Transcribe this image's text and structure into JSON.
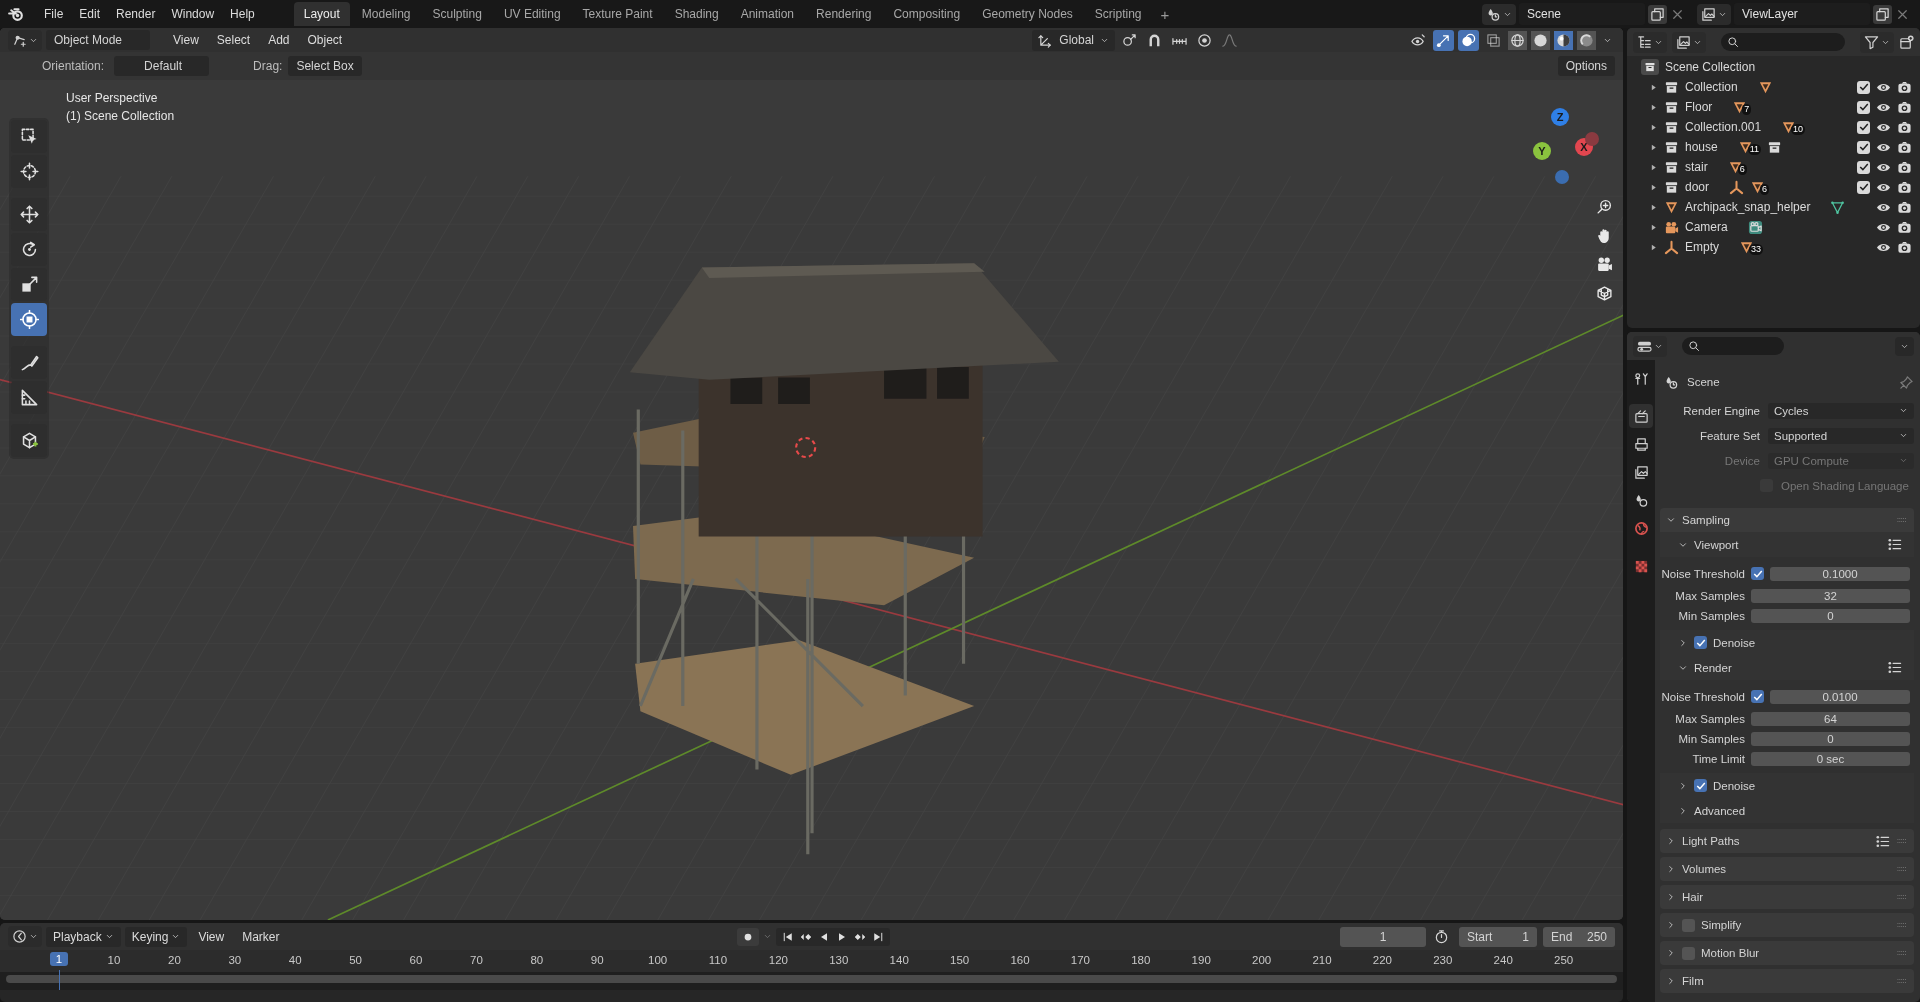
{
  "menu": [
    "File",
    "Edit",
    "Render",
    "Window",
    "Help"
  ],
  "workspaces": [
    {
      "label": "Layout",
      "selected": true
    },
    {
      "label": "Modeling",
      "selected": false
    },
    {
      "label": "Sculpting",
      "selected": false
    },
    {
      "label": "UV Editing",
      "selected": false
    },
    {
      "label": "Texture Paint",
      "selected": false
    },
    {
      "label": "Shading",
      "selected": false
    },
    {
      "label": "Animation",
      "selected": false
    },
    {
      "label": "Rendering",
      "selected": false
    },
    {
      "label": "Compositing",
      "selected": false
    },
    {
      "label": "Geometry Nodes",
      "selected": false
    },
    {
      "label": "Scripting",
      "selected": false
    }
  ],
  "add_workspace": "+",
  "scene": "Scene",
  "view_layer": "ViewLayer",
  "viewport_header": {
    "mode": "Object Mode",
    "menus": [
      "View",
      "Select",
      "Add",
      "Object"
    ],
    "orientation": "Global",
    "shading": [
      {
        "kind": "wireframe",
        "selected": false
      },
      {
        "kind": "solid",
        "selected": false
      },
      {
        "kind": "material",
        "selected": true
      },
      {
        "kind": "rendered",
        "selected": false
      }
    ]
  },
  "tool_settings": {
    "orientation_label": "Orientation:",
    "orientation": "Default",
    "drag_label": "Drag:",
    "drag": "Select Box",
    "options": "Options"
  },
  "viewport": {
    "view_name": "User Perspective",
    "collection": "(1) Scene Collection",
    "tools": [
      {
        "kind": "select",
        "selected": false
      },
      {
        "kind": "cursor",
        "selected": false
      },
      {
        "kind": "move",
        "selected": false
      },
      {
        "kind": "rotate",
        "selected": false
      },
      {
        "kind": "scale",
        "selected": false
      },
      {
        "kind": "transform",
        "selected": true
      },
      {
        "kind": "annotate",
        "selected": false
      },
      {
        "kind": "measure",
        "selected": false
      },
      {
        "kind": "add-cube",
        "selected": false
      }
    ],
    "gizmo": [
      {
        "label": "Z",
        "color": "#2f7fe6"
      },
      {
        "label": "Y",
        "color": "#8ac33e"
      },
      {
        "label": "X",
        "color": "#e2464f"
      }
    ]
  },
  "outliner": {
    "root": "Scene Collection",
    "items": [
      {
        "name": "Collection",
        "kind": "collection",
        "checked": true,
        "extras": [
          {
            "kind": "mesh"
          }
        ]
      },
      {
        "name": "Floor",
        "kind": "collection",
        "checked": true,
        "extras": [
          {
            "kind": "mesh",
            "count": "7"
          }
        ]
      },
      {
        "name": "Collection.001",
        "kind": "collection",
        "checked": true,
        "extras": [
          {
            "kind": "mesh",
            "count": "10"
          }
        ]
      },
      {
        "name": "house",
        "kind": "collection",
        "checked": true,
        "extras": [
          {
            "kind": "mesh",
            "count": "11"
          },
          {
            "kind": "collection"
          }
        ]
      },
      {
        "name": "stair",
        "kind": "collection",
        "checked": true,
        "extras": [
          {
            "kind": "mesh",
            "count": "6"
          }
        ]
      },
      {
        "name": "door",
        "kind": "collection",
        "checked": true,
        "extras": [
          {
            "kind": "empty"
          },
          {
            "kind": "mesh",
            "count": "6"
          }
        ]
      },
      {
        "name": "Archipack_snap_helper",
        "kind": "mesh",
        "extras": [
          {
            "kind": "mesh-data"
          }
        ]
      },
      {
        "name": "Camera",
        "kind": "camera",
        "extras": [
          {
            "kind": "camera-data"
          }
        ]
      },
      {
        "name": "Empty",
        "kind": "empty",
        "extras": [
          {
            "kind": "mesh",
            "count": "33"
          }
        ]
      }
    ]
  },
  "properties": {
    "tabs": [
      {
        "kind": "tool",
        "selected": false
      },
      {
        "kind": "render",
        "selected": true
      },
      {
        "kind": "output",
        "selected": false
      },
      {
        "kind": "view-layer",
        "selected": false
      },
      {
        "kind": "scene",
        "selected": false
      },
      {
        "kind": "world",
        "selected": false
      },
      {
        "kind": "texture",
        "selected": false
      }
    ],
    "context": "Scene",
    "fields": [
      {
        "label": "Render Engine",
        "value": "Cycles",
        "disabled": false
      },
      {
        "label": "Feature Set",
        "value": "Supported",
        "disabled": false
      },
      {
        "label": "Device",
        "value": "GPU Compute",
        "disabled": true
      }
    ],
    "osl": {
      "label": "Open Shading Language",
      "checked": false,
      "disabled": true
    },
    "panels": [
      {
        "title": "Sampling",
        "expanded": true,
        "presets": false,
        "children": [
          {
            "kind": "subpanel",
            "title": "Viewport",
            "expanded": true,
            "presets": true,
            "rows": [
              {
                "kind": "check-number",
                "label": "Noise Threshold",
                "checked": true,
                "value": "0.1000"
              },
              {
                "kind": "number",
                "label": "Max Samples",
                "value": "32"
              },
              {
                "kind": "number",
                "label": "Min Samples",
                "value": "0"
              }
            ]
          },
          {
            "kind": "check-subpanel",
            "title": "Denoise",
            "checked": true,
            "expanded": false
          },
          {
            "kind": "subpanel",
            "title": "Render",
            "expanded": true,
            "presets": true,
            "rows": [
              {
                "kind": "check-number",
                "label": "Noise Threshold",
                "checked": true,
                "value": "0.0100"
              },
              {
                "kind": "number",
                "label": "Max Samples",
                "value": "64"
              },
              {
                "kind": "number",
                "label": "Min Samples",
                "value": "0"
              },
              {
                "kind": "number",
                "label": "Time Limit",
                "value": "0 sec"
              }
            ]
          },
          {
            "kind": "check-subpanel",
            "title": "Denoise",
            "checked": true,
            "expanded": false
          },
          {
            "kind": "subpanel",
            "title": "Advanced",
            "expanded": false,
            "presets": false
          }
        ]
      },
      {
        "title": "Light Paths",
        "expanded": false,
        "presets": true
      },
      {
        "title": "Volumes",
        "expanded": false,
        "presets": false
      },
      {
        "title": "Hair",
        "expanded": false,
        "presets": false
      },
      {
        "title": "Simplify",
        "expanded": false,
        "presets": false,
        "checked": false
      },
      {
        "title": "Motion Blur",
        "expanded": false,
        "presets": false,
        "checked": false
      },
      {
        "title": "Film",
        "expanded": false,
        "presets": false
      }
    ]
  },
  "timeline": {
    "menus": [
      {
        "label": "Playback",
        "dropdown": true
      },
      {
        "label": "Keying",
        "dropdown": true
      },
      {
        "label": "View",
        "dropdown": false
      },
      {
        "label": "Marker",
        "dropdown": false
      }
    ],
    "current_frame": "1",
    "start_label": "Start",
    "start": "1",
    "end_label": "End",
    "end": "250",
    "playhead": "1",
    "ruler": [
      "10",
      "20",
      "30",
      "40",
      "50",
      "60",
      "70",
      "80",
      "90",
      "100",
      "110",
      "120",
      "130",
      "140",
      "150",
      "160",
      "170",
      "180",
      "190",
      "200",
      "210",
      "220",
      "230",
      "240",
      "250"
    ]
  }
}
